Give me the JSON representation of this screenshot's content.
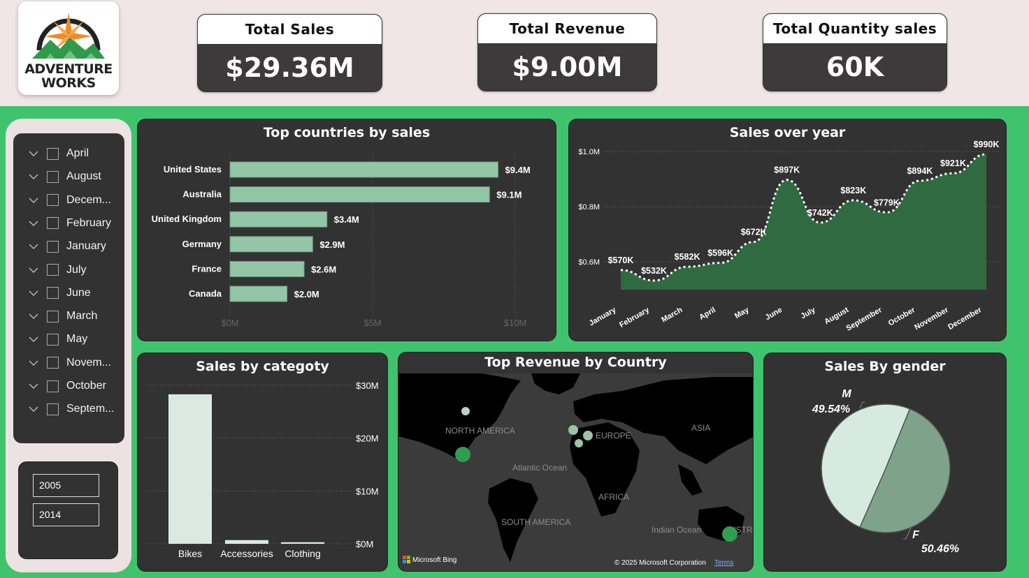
{
  "brand": {
    "line1": "ADVENTURE",
    "line2": "WORKS"
  },
  "kpis": [
    {
      "title": "Total Sales",
      "value": "$29.36M"
    },
    {
      "title": "Total Revenue",
      "value": "$9.00M"
    },
    {
      "title": "Total Quantity sales",
      "value": "60K"
    }
  ],
  "month_slicer": [
    "April",
    "August",
    "Decem...",
    "February",
    "January",
    "July",
    "June",
    "March",
    "May",
    "Novem...",
    "October",
    "Septem..."
  ],
  "year_slicer": {
    "start": "2005",
    "end": "2014"
  },
  "countries_chart": {
    "title": "Top countries by sales",
    "categories": [
      "United States",
      "Australia",
      "United Kingdom",
      "Germany",
      "France",
      "Canada"
    ],
    "values": [
      9.4,
      9.1,
      3.4,
      2.9,
      2.6,
      2.0
    ],
    "labels": [
      "$9.4M",
      "$9.1M",
      "$3.4M",
      "$2.9M",
      "$2.6M",
      "$2.0M"
    ],
    "ticks": [
      "$0M",
      "$5M",
      "$10M"
    ],
    "tick_values": [
      0,
      5,
      10
    ],
    "bar_color": "#93c6a6"
  },
  "sales_year_chart": {
    "title": "Sales over year",
    "categories": [
      "January",
      "February",
      "March",
      "April",
      "May",
      "June",
      "July",
      "August",
      "September",
      "October",
      "November",
      "December"
    ],
    "values": [
      0.57,
      0.532,
      0.582,
      0.596,
      0.672,
      0.897,
      0.742,
      0.823,
      0.779,
      0.894,
      0.921,
      0.99
    ],
    "labels": [
      "$570K",
      "$532K",
      "$582K",
      "$596K",
      "$672K",
      "$897K",
      "$742K",
      "$823K",
      "$779K",
      "$894K",
      "$921K",
      "$990K"
    ],
    "ticks": [
      "$0.6M",
      "$0.8M",
      "$1.0M"
    ],
    "tick_values": [
      0.6,
      0.8,
      1.0
    ],
    "fill_color": "#2f6a41"
  },
  "category_chart": {
    "title": "Sales by categoty",
    "categories": [
      "Bikes",
      "Accessories",
      "Clothing"
    ],
    "values": [
      28.3,
      0.7,
      0.3
    ],
    "ticks": [
      "$0M",
      "$10M",
      "$20M",
      "$30M"
    ],
    "tick_values": [
      0,
      10,
      20,
      30
    ],
    "bar_color": "#dbeae1"
  },
  "map": {
    "title": "Top Revenue by Country",
    "labels": [
      "NORTH AMERICA",
      "EUROPE",
      "ASIA",
      "Atlantic Ocean",
      "AFRICA",
      "SOUTH AMERICA",
      "Indian Ocean",
      "AUSTR"
    ],
    "attribution": "Microsoft Bing",
    "copyright": "© 2025 Microsoft Corporation",
    "terms": "Terms"
  },
  "gender_chart": {
    "title": "Sales By gender",
    "slices": [
      {
        "label": "M",
        "percent_label": "49.54%",
        "value": 49.54,
        "color": "#d7eadf"
      },
      {
        "label": "F",
        "percent_label": "50.46%",
        "value": 50.46,
        "color": "#7ea38a"
      }
    ]
  },
  "chart_data": [
    {
      "type": "bar",
      "title": "Top countries by sales",
      "orientation": "horizontal",
      "categories": [
        "United States",
        "Australia",
        "United Kingdom",
        "Germany",
        "France",
        "Canada"
      ],
      "values": [
        9.4,
        9.1,
        3.4,
        2.9,
        2.6,
        2.0
      ],
      "xlim": [
        0,
        10
      ]
    },
    {
      "type": "area",
      "title": "Sales over year",
      "categories": [
        "January",
        "February",
        "March",
        "April",
        "May",
        "June",
        "July",
        "August",
        "September",
        "October",
        "November",
        "December"
      ],
      "values": [
        570,
        532,
        582,
        596,
        672,
        897,
        742,
        823,
        779,
        894,
        921,
        990
      ],
      "ylim": [
        0.6,
        1.0
      ]
    },
    {
      "type": "bar",
      "title": "Sales by categoty",
      "categories": [
        "Bikes",
        "Accessories",
        "Clothing"
      ],
      "values": [
        28.3,
        0.7,
        0.3
      ],
      "ylim": [
        0,
        30
      ]
    },
    {
      "type": "pie",
      "title": "Sales By gender",
      "categories": [
        "M",
        "F"
      ],
      "values": [
        49.54,
        50.46
      ]
    }
  ]
}
